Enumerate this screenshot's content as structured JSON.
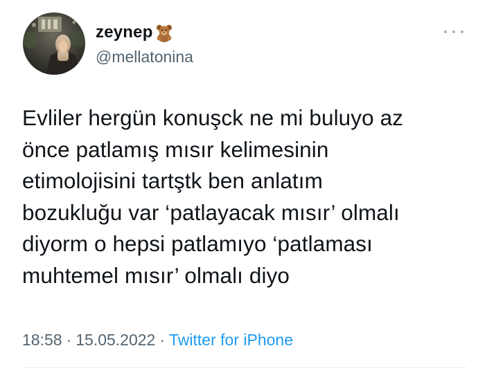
{
  "user": {
    "display_name": "zeynep",
    "name_emoji_icon": "teddy-bear-icon",
    "handle": "@mellatonina"
  },
  "tweet": {
    "lines": [
      "Evliler hergün konuşck ne mi buluyo az",
      "önce patlamış mısır kelimesinin",
      "etimolojisini tartştk ben anlatım",
      "bozukluğu var ‘patlayacak mısır’ olmalı",
      "diyorm o hepsi patlamıyo ‘patlaması",
      "muhtemel mısır’ olmalı diyo"
    ]
  },
  "meta": {
    "time": "18:58",
    "separator": "·",
    "date": "15.05.2022",
    "source": "Twitter for iPhone"
  },
  "colors": {
    "text": "#0f1419",
    "secondary": "#536471",
    "link": "#1d9bf0",
    "divider": "#e6ecf0"
  }
}
